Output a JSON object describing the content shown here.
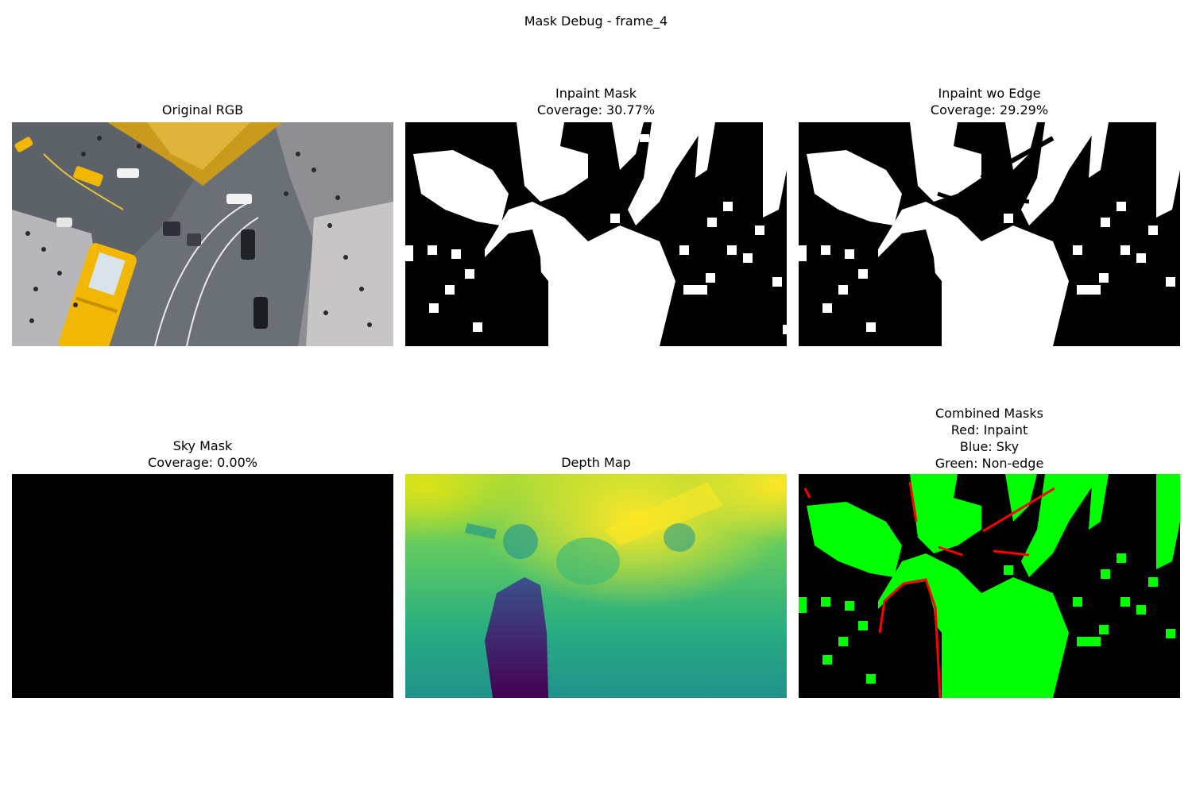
{
  "figure": {
    "suptitle": "Mask Debug - frame_4"
  },
  "panels": [
    {
      "id": "original-rgb",
      "title_lines": [
        "Original RGB"
      ]
    },
    {
      "id": "inpaint-mask",
      "title_lines": [
        "Inpaint Mask",
        "Coverage: 30.77%"
      ],
      "coverage_percent": 30.77
    },
    {
      "id": "inpaint-wo-edge",
      "title_lines": [
        "Inpaint wo Edge",
        "Coverage: 29.29%"
      ],
      "coverage_percent": 29.29
    },
    {
      "id": "sky-mask",
      "title_lines": [
        "Sky Mask",
        "Coverage: 0.00%"
      ],
      "coverage_percent": 0.0
    },
    {
      "id": "depth-map",
      "title_lines": [
        "Depth Map"
      ]
    },
    {
      "id": "combined-masks",
      "title_lines": [
        "Combined Masks",
        "Red: Inpaint",
        "Blue: Sky",
        "Green: Non-edge"
      ]
    }
  ],
  "colors": {
    "mask_fill": "#ffffff",
    "mask_bg": "#000000",
    "combined_inpaint": "#ff0000",
    "combined_sky": "#0000ff",
    "combined_non_edge": "#00ff00",
    "depth_low": "#440154",
    "depth_mid": "#21918c",
    "depth_high": "#fde725",
    "taxi_yellow": "#f2b705",
    "road_gray": "#6b7076"
  }
}
